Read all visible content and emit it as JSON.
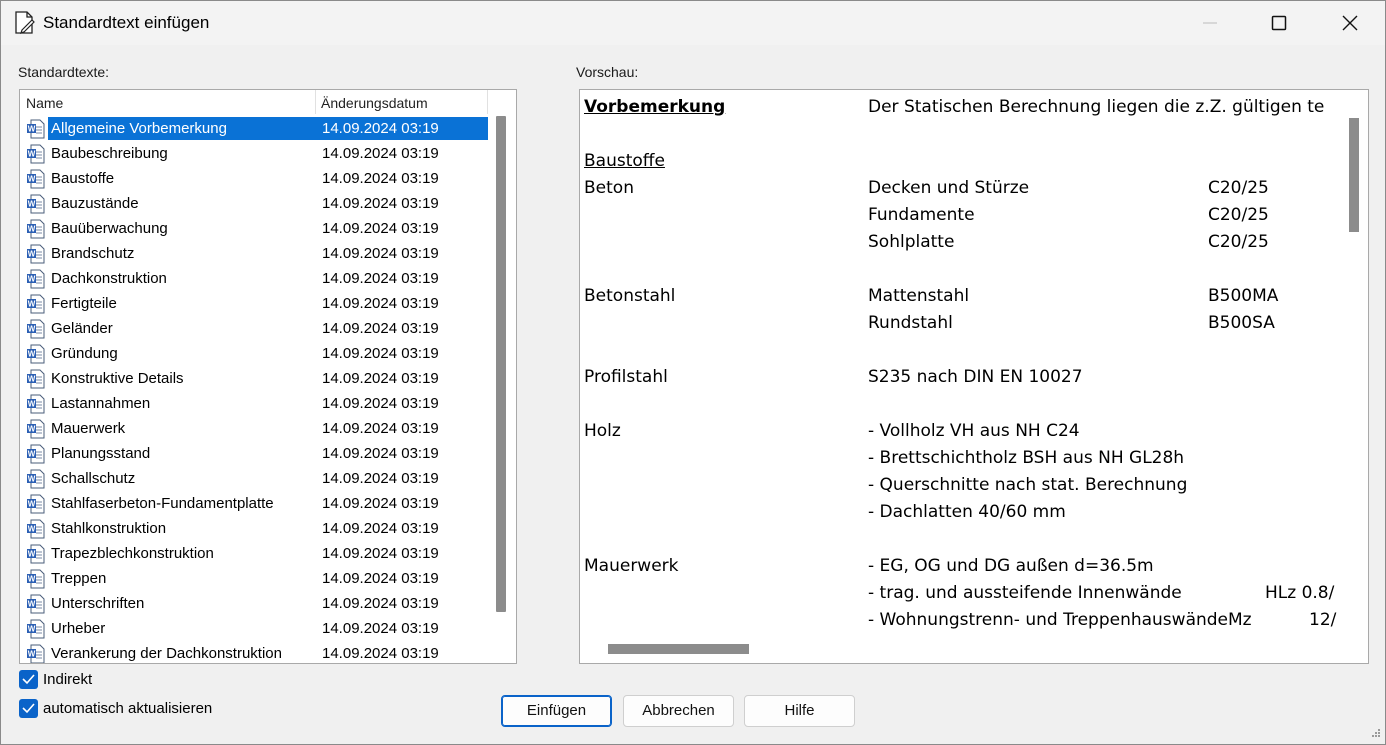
{
  "window": {
    "title": "Standardtext einfügen"
  },
  "labels": {
    "list": "Standardtexte:",
    "preview": "Vorschau:"
  },
  "list": {
    "columns": [
      "Name",
      "Änderungsdatum"
    ],
    "rows": [
      {
        "name": "Allgemeine Vorbemerkung",
        "date": "14.09.2024 03:19",
        "selected": true
      },
      {
        "name": "Baubeschreibung",
        "date": "14.09.2024 03:19"
      },
      {
        "name": "Baustoffe",
        "date": "14.09.2024 03:19"
      },
      {
        "name": "Bauzustände",
        "date": "14.09.2024 03:19"
      },
      {
        "name": "Bauüberwachung",
        "date": "14.09.2024 03:19"
      },
      {
        "name": "Brandschutz",
        "date": "14.09.2024 03:19"
      },
      {
        "name": "Dachkonstruktion",
        "date": "14.09.2024 03:19"
      },
      {
        "name": "Fertigteile",
        "date": "14.09.2024 03:19"
      },
      {
        "name": "Geländer",
        "date": "14.09.2024 03:19"
      },
      {
        "name": "Gründung",
        "date": "14.09.2024 03:19"
      },
      {
        "name": "Konstruktive Details",
        "date": "14.09.2024 03:19"
      },
      {
        "name": "Lastannahmen",
        "date": "14.09.2024 03:19"
      },
      {
        "name": "Mauerwerk",
        "date": "14.09.2024 03:19"
      },
      {
        "name": "Planungsstand",
        "date": "14.09.2024 03:19"
      },
      {
        "name": "Schallschutz",
        "date": "14.09.2024 03:19"
      },
      {
        "name": "Stahlfaserbeton-Fundamentplatte",
        "date": "14.09.2024 03:19"
      },
      {
        "name": "Stahlkonstruktion",
        "date": "14.09.2024 03:19"
      },
      {
        "name": "Trapezblechkonstruktion",
        "date": "14.09.2024 03:19"
      },
      {
        "name": "Treppen",
        "date": "14.09.2024 03:19"
      },
      {
        "name": "Unterschriften",
        "date": "14.09.2024 03:19"
      },
      {
        "name": "Urheber",
        "date": "14.09.2024 03:19"
      },
      {
        "name": "Verankerung der Dachkonstruktion",
        "date": "14.09.2024 03:19"
      }
    ]
  },
  "preview": {
    "vorbemerkung_heading": "Vorbemerkung",
    "vorbemerkung_text": "Der Statischen Berechnung liegen die z.Z. gültigen te",
    "baustoffe_heading": "Baustoffe",
    "beton": "Beton",
    "decken": "Decken und Stürze",
    "decken_val": "C20/25",
    "fundamente": "Fundamente",
    "fundamente_val": "C20/25",
    "sohlplatte": "Sohlplatte",
    "sohlplatte_val": "C20/25",
    "betonstahl": "Betonstahl",
    "mattenstahl": "Mattenstahl",
    "mattenstahl_val": "B500MA",
    "rundstahl": "Rundstahl",
    "rundstahl_val": "B500SA",
    "profilstahl": "Profilstahl",
    "profilstahl_text": "S235 nach DIN EN 10027",
    "holz": "Holz",
    "holz_1": "- Vollholz VH aus NH C24",
    "holz_2": "- Brettschichtholz BSH aus NH GL28h",
    "holz_3": "- Querschnitte nach stat. Berechnung",
    "holz_4": "- Dachlatten 40/60 mm",
    "mauerwerk": "Mauerwerk",
    "mw_1": "- EG, OG und DG außen d=36.5m",
    "mw_2": "- trag. und aussteifende Innenwände",
    "mw_2_val": "HLz 0.8/",
    "mw_3": "- Wohnungstrenn- und TreppenhauswändeMz",
    "mw_3_val": "12/"
  },
  "options": {
    "indirekt": {
      "label": "Indirekt",
      "checked": true
    },
    "auto_update": {
      "label": "automatisch aktualisieren",
      "checked": true
    }
  },
  "buttons": {
    "insert": "Einfügen",
    "cancel": "Abbrechen",
    "help": "Hilfe"
  }
}
